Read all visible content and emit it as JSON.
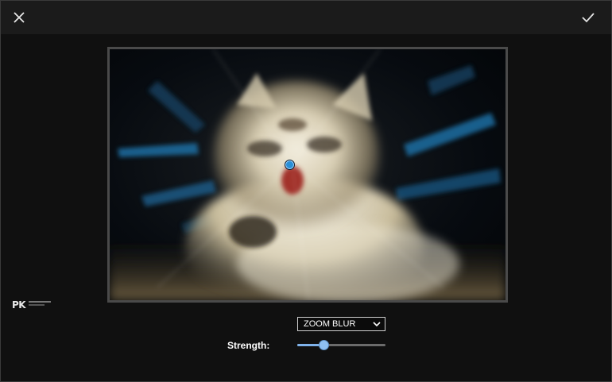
{
  "toolbar": {
    "close_icon": "close-icon",
    "confirm_icon": "checkmark-icon"
  },
  "editor": {
    "image_subject": "kitten photo with zoom blur effect",
    "focus_point_color": "#2a8fd6"
  },
  "watermark": {
    "text": "PK"
  },
  "controls": {
    "filter_select": {
      "value": "ZOOM BLUR"
    },
    "strength": {
      "label": "Strength:",
      "value": 0.3
    }
  },
  "colors": {
    "background": "#101010",
    "topbar": "#1b1b1b",
    "accent": "#8fc0f2"
  }
}
